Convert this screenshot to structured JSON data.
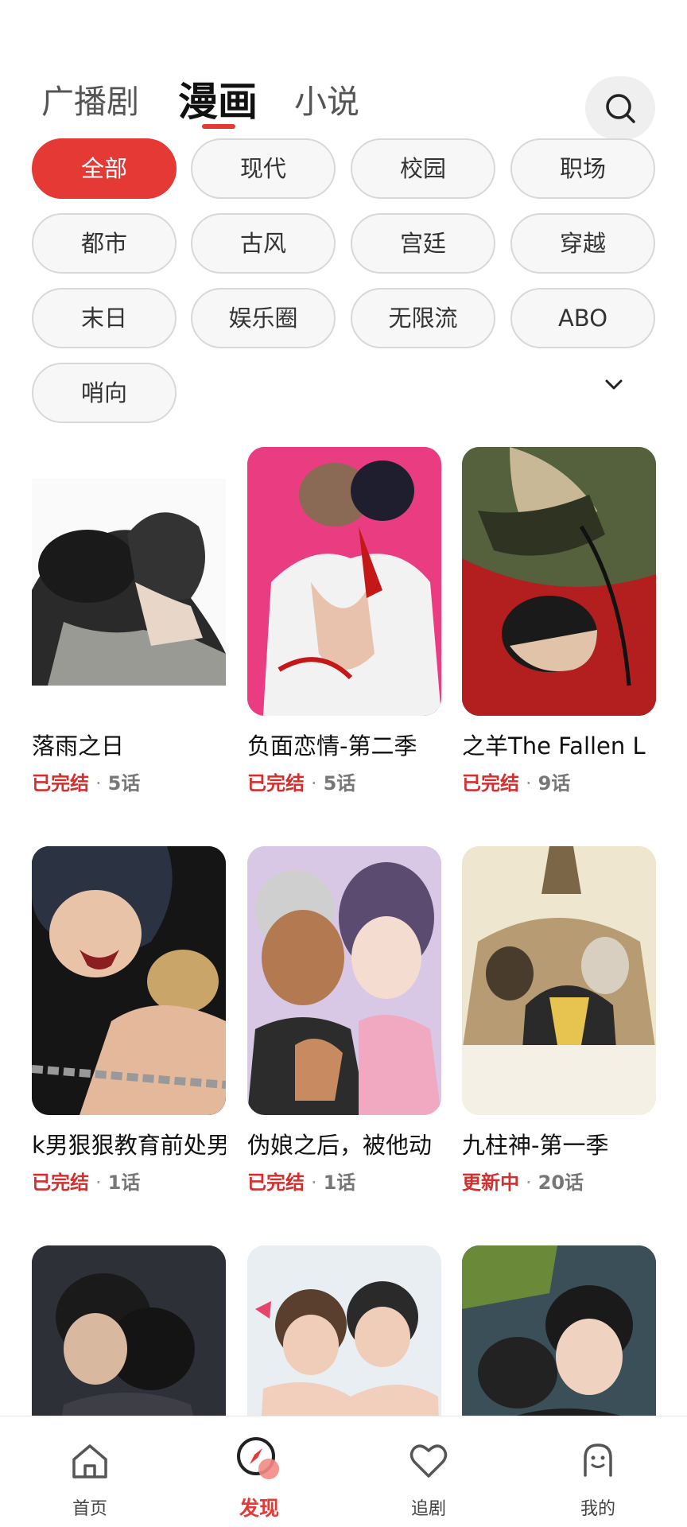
{
  "top_tabs": [
    {
      "label": "广播剧"
    },
    {
      "label": "漫画"
    },
    {
      "label": "小说"
    }
  ],
  "active_tab": "漫画",
  "categories": [
    {
      "label": "全部"
    },
    {
      "label": "现代"
    },
    {
      "label": "校园"
    },
    {
      "label": "职场"
    },
    {
      "label": "都市"
    },
    {
      "label": "古风"
    },
    {
      "label": "宫廷"
    },
    {
      "label": "穿越"
    },
    {
      "label": "末日"
    },
    {
      "label": "娱乐圈"
    },
    {
      "label": "无限流"
    },
    {
      "label": "ABO"
    },
    {
      "label": "哨向"
    }
  ],
  "active_category": "全部",
  "comics": [
    {
      "title": "落雨之日",
      "status": "已完结",
      "dot": "·",
      "episodes": "5话"
    },
    {
      "title": "负面恋情-第二季",
      "status": "已完结",
      "dot": "·",
      "episodes": "5话"
    },
    {
      "title": "之羊The Fallen L",
      "status": "已完结",
      "dot": "·",
      "episodes": "9话"
    },
    {
      "title": "k男狠狠教育前处男",
      "status": "已完结",
      "dot": "·",
      "episodes": "1话"
    },
    {
      "title": "伪娘之后，被他动",
      "status": "已完结",
      "dot": "·",
      "episodes": "1话"
    },
    {
      "title": "九柱神-第一季",
      "status": "更新中",
      "dot": "·",
      "episodes": "20话"
    },
    {
      "title": "",
      "status": "",
      "dot": "",
      "episodes": ""
    },
    {
      "title": "",
      "status": "",
      "dot": "",
      "episodes": ""
    },
    {
      "title": "",
      "status": "",
      "dot": "",
      "episodes": ""
    }
  ],
  "bottom_nav": [
    {
      "label": "首页",
      "icon": "home-icon"
    },
    {
      "label": "发现",
      "icon": "compass-icon"
    },
    {
      "label": "追剧",
      "icon": "heart-icon"
    },
    {
      "label": "我的",
      "icon": "profile-icon"
    }
  ],
  "colors": {
    "accent": "#e53935"
  }
}
